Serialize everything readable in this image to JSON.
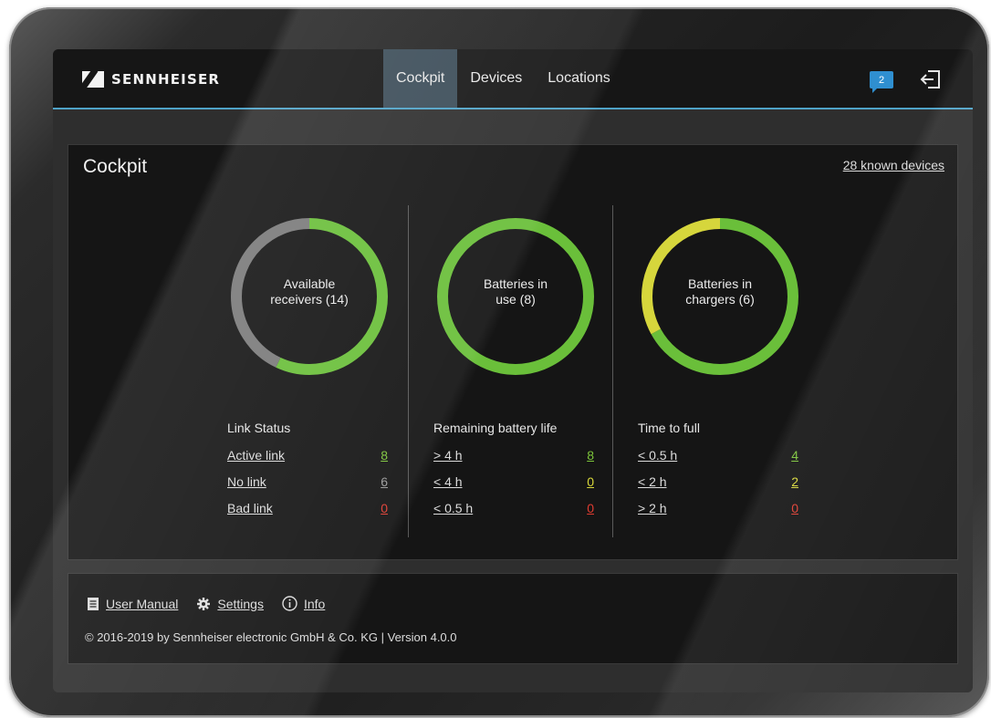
{
  "brand": {
    "name": "SENNHEISER"
  },
  "nav": {
    "tabs": [
      {
        "label": "Cockpit",
        "active": true
      },
      {
        "label": "Devices",
        "active": false
      },
      {
        "label": "Locations",
        "active": false
      }
    ]
  },
  "header": {
    "message_count": "2",
    "message_icon": "message-icon",
    "logout_icon": "logout-icon"
  },
  "cockpit": {
    "title": "Cockpit",
    "known_devices": "28 known devices",
    "columns": [
      {
        "donut_label_1": "Available",
        "donut_label_2": "receivers (14)",
        "donut_segments": [
          {
            "color": "#6abf3a",
            "fraction": 0.57
          },
          {
            "color": "#7a7a7a",
            "fraction": 0.43
          }
        ],
        "stats_title": "Link Status",
        "rows": [
          {
            "label": "Active link",
            "value": "8",
            "color": "green"
          },
          {
            "label": "No link",
            "value": "6",
            "color": "gray"
          },
          {
            "label": "Bad link",
            "value": "0",
            "color": "red"
          }
        ]
      },
      {
        "donut_label_1": "Batteries in",
        "donut_label_2": "use (8)",
        "donut_segments": [
          {
            "color": "#6abf3a",
            "fraction": 1.0
          }
        ],
        "stats_title": "Remaining battery life",
        "rows": [
          {
            "label": "> 4 h",
            "value": "8",
            "color": "green"
          },
          {
            "label": "< 4 h",
            "value": "0",
            "color": "yellow"
          },
          {
            "label": "< 0.5 h",
            "value": "0",
            "color": "red"
          }
        ]
      },
      {
        "donut_label_1": "Batteries in",
        "donut_label_2": "chargers (6)",
        "donut_segments": [
          {
            "color": "#6abf3a",
            "fraction": 0.67
          },
          {
            "color": "#d6d63c",
            "fraction": 0.33
          }
        ],
        "stats_title": "Time to full",
        "rows": [
          {
            "label": "< 0.5 h",
            "value": "4",
            "color": "green"
          },
          {
            "label": "< 2 h",
            "value": "2",
            "color": "yellow"
          },
          {
            "label": "> 2 h",
            "value": "0",
            "color": "red"
          }
        ]
      }
    ]
  },
  "footer": {
    "user_manual": "User Manual",
    "settings": "Settings",
    "info": "Info",
    "copyright": "© 2016-2019 by Sennheiser electronic GmbH & Co. KG | Version 4.0.0"
  },
  "colors": {
    "accent": "#4fa3c8",
    "ok": "#7cc43a",
    "warn": "#d8d83a",
    "error": "#e03c31",
    "neutral": "#9a9a9a"
  }
}
